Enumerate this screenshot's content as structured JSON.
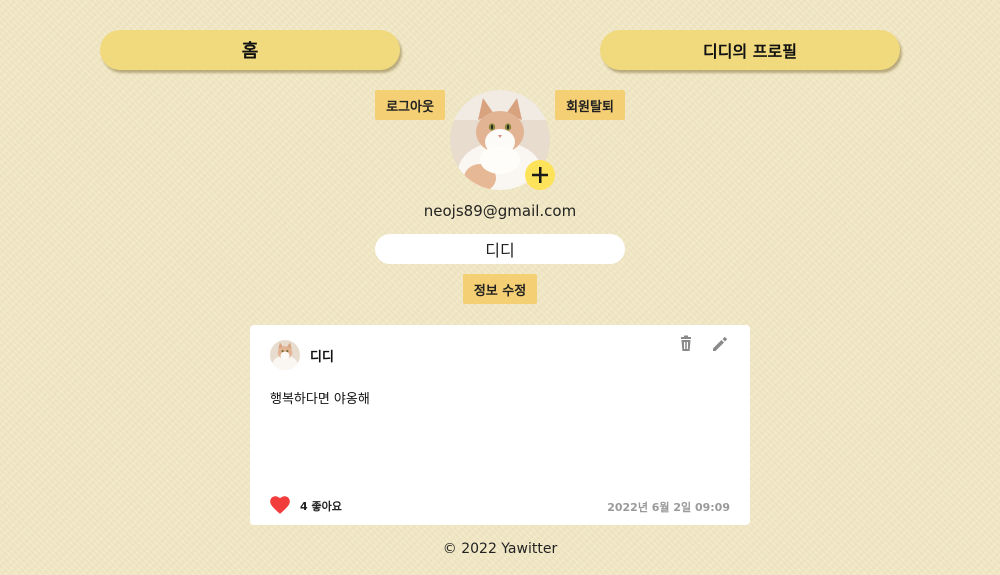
{
  "nav": {
    "home_label": "홈",
    "profile_label": "디디의 프로필"
  },
  "profile": {
    "logout_label": "로그아웃",
    "withdraw_label": "회원탈퇴",
    "email": "neojs89@gmail.com",
    "display_name": "디디",
    "edit_label": "정보 수정",
    "add_photo_icon": "plus-icon"
  },
  "post": {
    "author": "디디",
    "text": "행복하다면 야옹해",
    "likes_label": "4 좋아요",
    "like_count": 4,
    "date": "2022년 6월 2일 09:09",
    "icons": [
      "trash-icon",
      "pencil-icon",
      "heart-icon"
    ]
  },
  "footer": {
    "text": "© 2022 Yawitter"
  },
  "colors": {
    "background": "#f2e8c4",
    "nav_pill": "#f1da7e",
    "button": "#f4cf74",
    "add_photo": "#fde35a",
    "heart": "#f23c3c",
    "date": "#9a9a9a"
  }
}
